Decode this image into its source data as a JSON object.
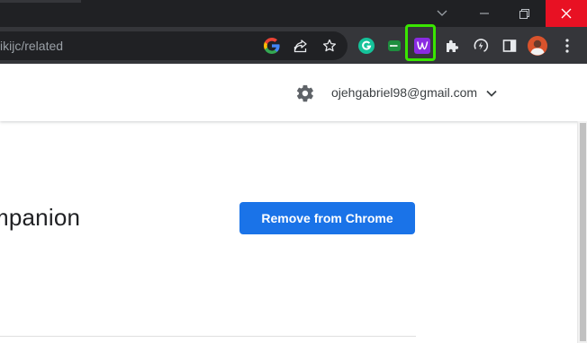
{
  "browser": {
    "address_bar": {
      "url_text": "ikijc/related"
    },
    "extensions": [
      {
        "name": "grammarly",
        "icon": "grammarly-icon",
        "color": "#15c39a",
        "letter": "G"
      },
      {
        "name": "chat",
        "icon": "chat-extension-icon",
        "color": "#1e8e3e"
      },
      {
        "name": "highlighted-extension",
        "icon": "purple-w-extension-icon",
        "color": "#8a2be2",
        "letter": "w"
      }
    ],
    "highlight_color": "#39e600"
  },
  "header": {
    "account_email": "ojehgabriel98@gmail.com"
  },
  "main": {
    "title_partial": "mpanion",
    "remove_button_label": "Remove from Chrome"
  },
  "colors": {
    "accent": "#1a73e8",
    "close": "#e81123",
    "toolbar": "#35363a",
    "titlebar": "#202124"
  }
}
